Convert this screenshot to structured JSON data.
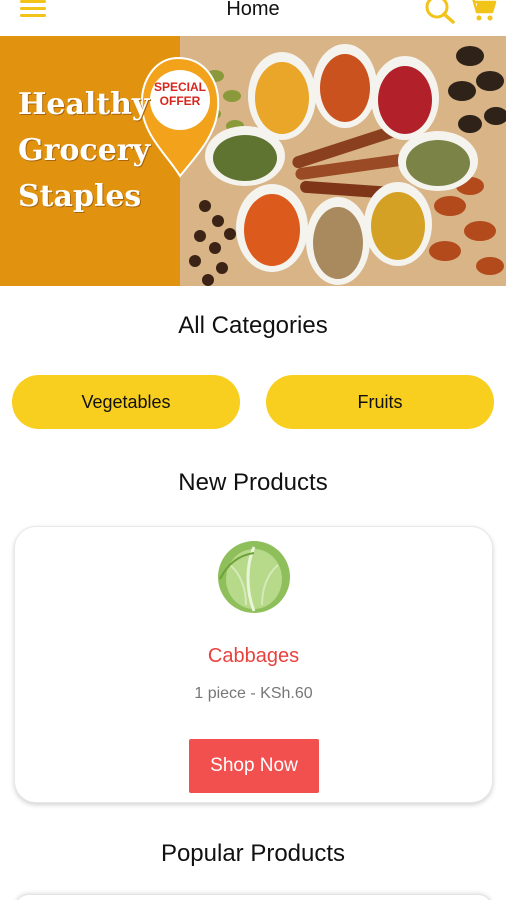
{
  "header": {
    "title": "Home",
    "menu_icon": "hamburger-menu-icon",
    "search_icon": "search-icon",
    "cart_icon": "cart-icon"
  },
  "banner": {
    "headline_lines": [
      "Healthy",
      "Grocery",
      "Staples"
    ],
    "badge_lines": [
      "SPECIAL",
      "OFFER"
    ]
  },
  "categories": {
    "title": "All Categories",
    "items": [
      {
        "label": "Vegetables"
      },
      {
        "label": "Fruits"
      }
    ]
  },
  "new_products": {
    "title": "New Products",
    "items": [
      {
        "name": "Cabbages",
        "price": "1 piece - KSh.60",
        "button": "Shop Now"
      }
    ]
  },
  "popular_products": {
    "title": "Popular Products"
  },
  "colors": {
    "accent_yellow": "#f8cf1e",
    "product_name_red": "#e8423f",
    "shop_button_red": "#f24f4f",
    "banner_orange": "#e19310"
  }
}
